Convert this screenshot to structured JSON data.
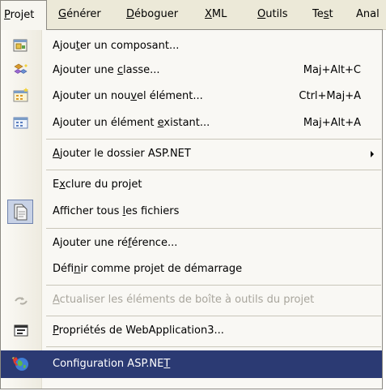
{
  "menubar": {
    "items": [
      {
        "pre": "",
        "acc": "P",
        "post": "rojet",
        "active": true
      },
      {
        "pre": "",
        "acc": "G",
        "post": "énérer"
      },
      {
        "pre": "",
        "acc": "D",
        "post": "éboguer"
      },
      {
        "pre": "",
        "acc": "X",
        "post": "ML"
      },
      {
        "pre": "",
        "acc": "O",
        "post": "utils"
      },
      {
        "pre": "Te",
        "acc": "s",
        "post": "t"
      },
      {
        "pre": "Anal",
        "acc": "",
        "post": ""
      }
    ]
  },
  "menu": {
    "items": [
      {
        "icon": "add-component-icon",
        "pre": "Ajou",
        "acc": "t",
        "post": "er un composant...",
        "shortcut": ""
      },
      {
        "icon": "add-class-icon",
        "pre": "Ajouter une ",
        "acc": "c",
        "post": "lasse...",
        "shortcut": "Maj+Alt+C"
      },
      {
        "icon": "add-new-item-icon",
        "pre": "Ajouter un nou",
        "acc": "v",
        "post": "el élément...",
        "shortcut": "Ctrl+Maj+A"
      },
      {
        "icon": "add-existing-item-icon",
        "pre": "Ajouter un élément ",
        "acc": "e",
        "post": "xistant...",
        "shortcut": "Maj+Alt+A"
      },
      {
        "icon": "",
        "pre": "",
        "acc": "A",
        "post": "jouter le dossier ASP.NET",
        "shortcut": "",
        "submenu": true
      },
      {
        "icon": "",
        "pre": "E",
        "acc": "x",
        "post": "clure du projet",
        "shortcut": ""
      },
      {
        "icon": "show-all-files-icon",
        "pre": "Afficher tous ",
        "acc": "l",
        "post": "es fichiers",
        "shortcut": ""
      },
      {
        "icon": "",
        "pre": "Ajouter une ré",
        "acc": "f",
        "post": "érence...",
        "shortcut": ""
      },
      {
        "icon": "",
        "pre": "Défi",
        "acc": "n",
        "post": "ir comme projet de démarrage",
        "shortcut": ""
      },
      {
        "icon": "refresh-toolbox-icon",
        "pre": "",
        "acc": "A",
        "post": "ctualiser les éléments de boîte à outils du projet",
        "shortcut": "",
        "disabled": true
      },
      {
        "icon": "properties-icon",
        "pre": "",
        "acc": "P",
        "post": "ropriétés de WebApplication3...",
        "shortcut": ""
      },
      {
        "icon": "asp-net-configuration-icon",
        "pre": "Configuration ASP.NE",
        "acc": "T",
        "post": "",
        "shortcut": "",
        "highlight": true
      }
    ]
  },
  "colors": {
    "menubar_bg": "#ece9d8",
    "menu_bg": "#f9f8f4",
    "highlight_bg": "#2b3a73",
    "disabled_text": "#a8a59c"
  }
}
